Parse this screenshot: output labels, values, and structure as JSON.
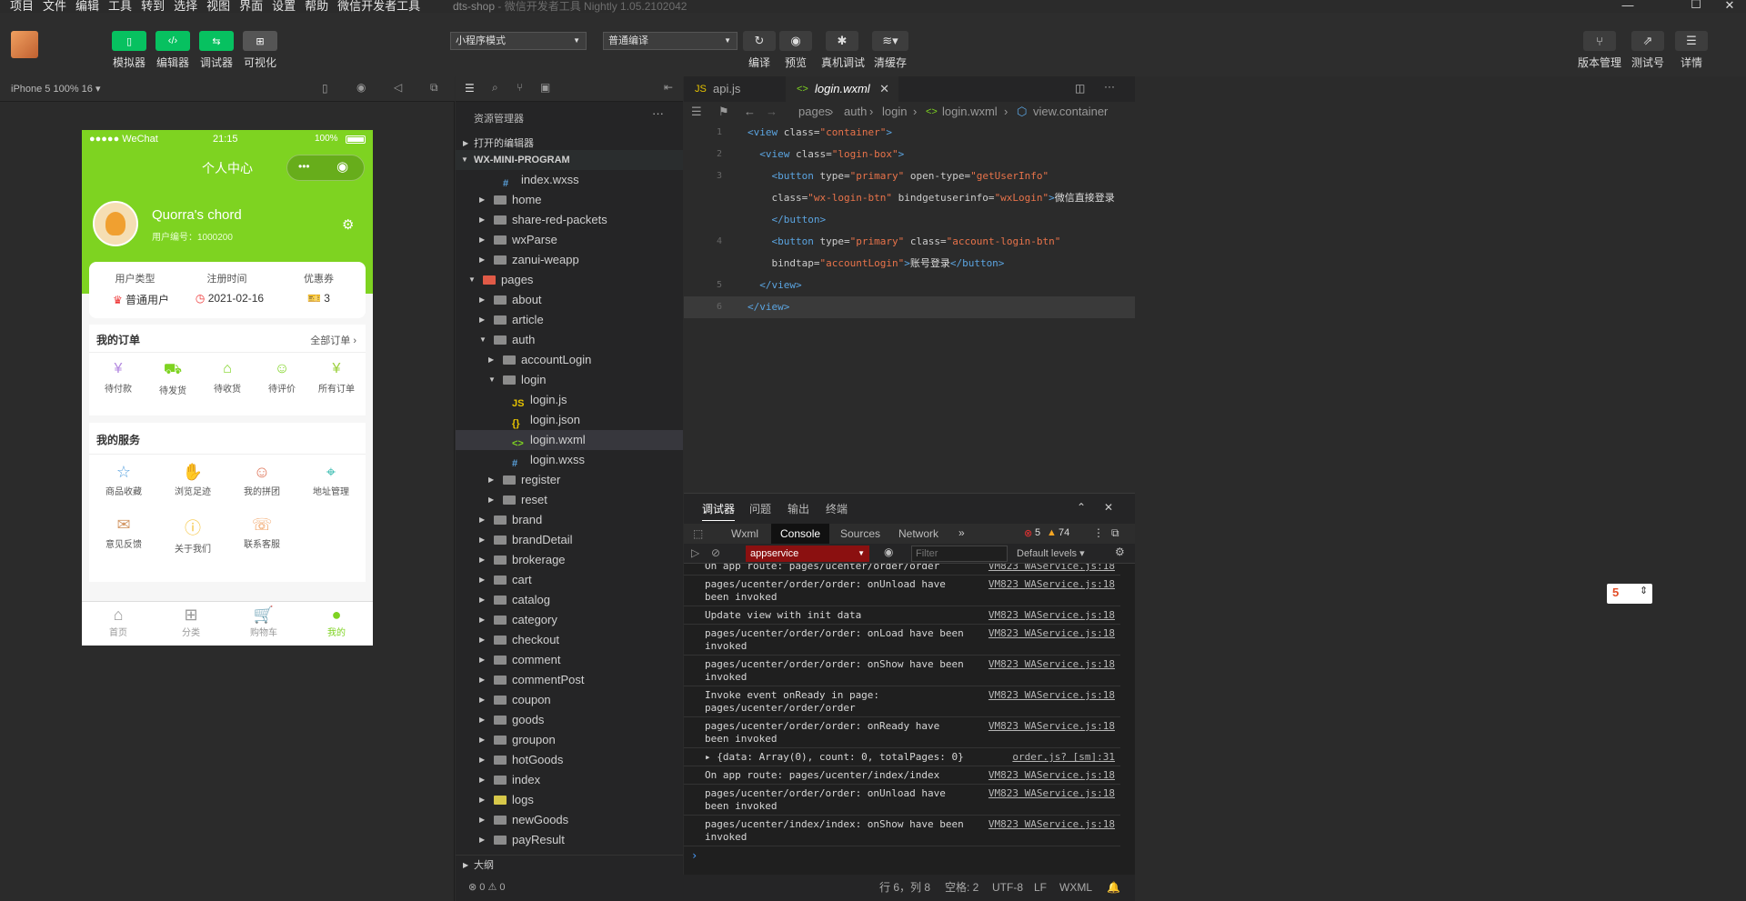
{
  "menu": [
    "项目",
    "文件",
    "编辑",
    "工具",
    "转到",
    "选择",
    "视图",
    "界面",
    "设置",
    "帮助",
    "微信开发者工具"
  ],
  "window_title": "dts-shop",
  "window_subtitle": "- 微信开发者工具 Nightly 1.05.2102042",
  "toolbar": {
    "simulator": "模拟器",
    "editor": "编辑器",
    "debugger": "调试器",
    "visual": "可视化",
    "mode_select": "小程序模式",
    "compile_select": "普通编译",
    "compile": "编译",
    "preview": "预览",
    "real_debug": "真机调试",
    "clear_cache": "清缓存",
    "version_mgmt": "版本管理",
    "test_id": "测试号",
    "details": "详情"
  },
  "sim": {
    "device": "iPhone 5 100% 16 ▾",
    "status_left": "●●●●● WeChat",
    "time": "21:15",
    "battery": "100%",
    "nav_title": "个人中心",
    "user_name": "Quorra's chord",
    "user_id_label": "用户编号：1000200",
    "stats": [
      {
        "label": "用户类型",
        "value": "普通用户"
      },
      {
        "label": "注册时间",
        "value": "2021-02-16"
      },
      {
        "label": "优惠券",
        "value": "3"
      }
    ],
    "orders_title": "我的订单",
    "orders_all": "全部订单",
    "orders": [
      "待付款",
      "待发货",
      "待收货",
      "待评价",
      "所有订单"
    ],
    "services_title": "我的服务",
    "services": [
      "商品收藏",
      "浏览足迹",
      "我的拼团",
      "地址管理",
      "意见反馈",
      "关于我们",
      "联系客服"
    ],
    "tabbar": [
      "首页",
      "分类",
      "购物车",
      "我的"
    ]
  },
  "explorer": {
    "title": "资源管理器",
    "open_editors": "打开的编辑器",
    "project": "WX-MINI-PROGRAM",
    "items": [
      {
        "label": "index.wxss",
        "depth": 2,
        "type": "wxss"
      },
      {
        "label": "home",
        "depth": 1,
        "type": "folder"
      },
      {
        "label": "share-red-packets",
        "depth": 1,
        "type": "folder"
      },
      {
        "label": "wxParse",
        "depth": 1,
        "type": "folder"
      },
      {
        "label": "zanui-weapp",
        "depth": 1,
        "type": "folder"
      },
      {
        "label": "pages",
        "depth": 0,
        "type": "folder-open-red"
      },
      {
        "label": "about",
        "depth": 1,
        "type": "folder"
      },
      {
        "label": "article",
        "depth": 1,
        "type": "folder"
      },
      {
        "label": "auth",
        "depth": 1,
        "type": "folder-open"
      },
      {
        "label": "accountLogin",
        "depth": 2,
        "type": "folder"
      },
      {
        "label": "login",
        "depth": 2,
        "type": "folder-open"
      },
      {
        "label": "login.js",
        "depth": 3,
        "type": "js"
      },
      {
        "label": "login.json",
        "depth": 3,
        "type": "json"
      },
      {
        "label": "login.wxml",
        "depth": 3,
        "type": "wxml"
      },
      {
        "label": "login.wxss",
        "depth": 3,
        "type": "wxss"
      },
      {
        "label": "register",
        "depth": 2,
        "type": "folder"
      },
      {
        "label": "reset",
        "depth": 2,
        "type": "folder"
      },
      {
        "label": "brand",
        "depth": 1,
        "type": "folder"
      },
      {
        "label": "brandDetail",
        "depth": 1,
        "type": "folder"
      },
      {
        "label": "brokerage",
        "depth": 1,
        "type": "folder"
      },
      {
        "label": "cart",
        "depth": 1,
        "type": "folder"
      },
      {
        "label": "catalog",
        "depth": 1,
        "type": "folder"
      },
      {
        "label": "category",
        "depth": 1,
        "type": "folder"
      },
      {
        "label": "checkout",
        "depth": 1,
        "type": "folder"
      },
      {
        "label": "comment",
        "depth": 1,
        "type": "folder"
      },
      {
        "label": "commentPost",
        "depth": 1,
        "type": "folder"
      },
      {
        "label": "coupon",
        "depth": 1,
        "type": "folder"
      },
      {
        "label": "goods",
        "depth": 1,
        "type": "folder"
      },
      {
        "label": "groupon",
        "depth": 1,
        "type": "folder"
      },
      {
        "label": "hotGoods",
        "depth": 1,
        "type": "folder"
      },
      {
        "label": "index",
        "depth": 1,
        "type": "folder"
      },
      {
        "label": "logs",
        "depth": 1,
        "type": "folder-yellow"
      },
      {
        "label": "newGoods",
        "depth": 1,
        "type": "folder"
      },
      {
        "label": "payResult",
        "depth": 1,
        "type": "folder"
      }
    ],
    "outline": "大纲",
    "problems": "⊗ 0 ⚠ 0"
  },
  "editor": {
    "tabs": [
      {
        "label": "api.js"
      },
      {
        "label": "login.wxml"
      }
    ],
    "breadcrumb": [
      "pages",
      "auth",
      "login",
      "login.wxml",
      "view.container"
    ],
    "code": [
      {
        "n": "1",
        "html": "<span class='tag'>&lt;view</span> <span class='att'>class=</span><span class='str'>\"container\"</span><span class='tag'>&gt;</span>"
      },
      {
        "n": "2",
        "html": "&nbsp;&nbsp;<span class='tag'>&lt;view</span> <span class='att'>class=</span><span class='str'>\"login-box\"</span><span class='tag'>&gt;</span>"
      },
      {
        "n": "3",
        "html": "&nbsp;&nbsp;&nbsp;&nbsp;<span class='tag'>&lt;button</span> <span class='att'>type=</span><span class='str'>\"primary\"</span> <span class='att'>open-type=</span><span class='str'>\"getUserInfo\"</span>"
      },
      {
        "n": "",
        "html": "&nbsp;&nbsp;&nbsp;&nbsp;<span class='att'>class=</span><span class='str'>\"wx-login-btn\"</span> <span class='att'>bindgetuserinfo=</span><span class='str'>\"wxLogin\"</span><span class='tag'>&gt;</span><span class='txt'>微信直接登录</span>"
      },
      {
        "n": "",
        "html": "&nbsp;&nbsp;&nbsp;&nbsp;<span class='tag'>&lt;/button&gt;</span>"
      },
      {
        "n": "4",
        "html": "&nbsp;&nbsp;&nbsp;&nbsp;<span class='tag'>&lt;button</span> <span class='att'>type=</span><span class='str'>\"primary\"</span> <span class='att'>class=</span><span class='str'>\"account-login-btn\"</span>"
      },
      {
        "n": "",
        "html": "&nbsp;&nbsp;&nbsp;&nbsp;<span class='att'>bindtap=</span><span class='str'>\"accountLogin\"</span><span class='tag'>&gt;</span><span class='txt'>账号登录</span><span class='tag'>&lt;/button&gt;</span>"
      },
      {
        "n": "5",
        "html": "&nbsp;&nbsp;<span class='tag'>&lt;/view&gt;</span>"
      },
      {
        "n": "6",
        "html": "<span class='tag'>&lt;/view&gt;</span>"
      }
    ]
  },
  "debugger": {
    "top_tabs": [
      "调试器",
      "问题",
      "输出",
      "终端"
    ],
    "dev_tabs": [
      "Wxml",
      "Console",
      "Sources",
      "Network"
    ],
    "errors": "5",
    "warnings": "74",
    "context": "appservice",
    "filter_placeholder": "Filter",
    "levels": "Default levels ▾",
    "logs": [
      {
        "text": "On app route: pages/ucenter/order/order",
        "src": "VM823 WAService.js:18"
      },
      {
        "text": "pages/ucenter/order/order: onUnload have\nbeen invoked",
        "src": "VM823 WAService.js:18"
      },
      {
        "text": "Update view with init data",
        "src": "VM823 WAService.js:18"
      },
      {
        "text": "pages/ucenter/order/order: onLoad have been\ninvoked",
        "src": "VM823 WAService.js:18"
      },
      {
        "text": "pages/ucenter/order/order: onShow have been\ninvoked",
        "src": "VM823 WAService.js:18"
      },
      {
        "text": "Invoke event onReady in page:\npages/ucenter/order/order",
        "src": "VM823 WAService.js:18"
      },
      {
        "text": "pages/ucenter/order/order: onReady have\nbeen invoked",
        "src": "VM823 WAService.js:18"
      },
      {
        "text": "▸ {data: Array(0), count: 0, totalPages: 0}",
        "src": "order.js? [sm]:31"
      },
      {
        "text": "On app route: pages/ucenter/index/index",
        "src": "VM823 WAService.js:18"
      },
      {
        "text": "pages/ucenter/order/order: onUnload have\nbeen invoked",
        "src": "VM823 WAService.js:18"
      },
      {
        "text": "pages/ucenter/index/index: onShow have been\ninvoked",
        "src": "VM823 WAService.js:18"
      }
    ],
    "prompt": "›"
  },
  "status": {
    "pos": "行 6，列 8",
    "spaces": "空格: 2",
    "encoding": "UTF-8",
    "eol": "LF",
    "lang": "WXML"
  },
  "colors": {
    "accent_green": "#07c160",
    "wechat_green": "#7ed321"
  }
}
